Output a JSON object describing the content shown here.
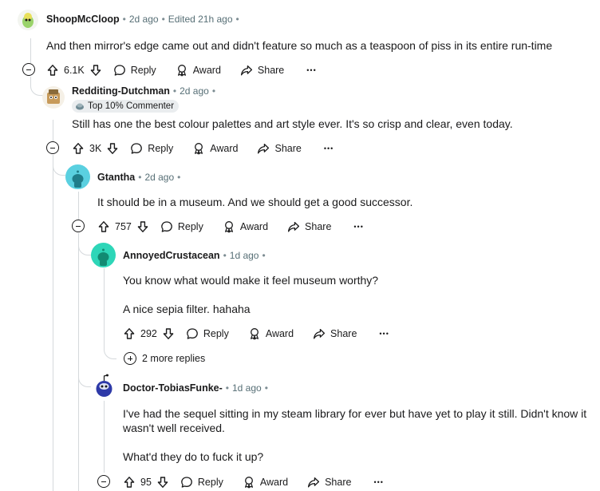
{
  "comments": [
    {
      "author": "ShoopMcCloop",
      "time": "2d ago",
      "edited": "Edited 21h ago",
      "body": [
        "And then mirror's edge came out and didn't feature so much as a teaspoon of piss in its entire run-time"
      ],
      "score": "6.1K"
    },
    {
      "author": "Redditing-Dutchman",
      "time": "2d ago",
      "badge": "Top 10% Commenter",
      "body": [
        "Still has one the best colour palettes and art style ever. It's so crisp and clear, even today."
      ],
      "score": "3K"
    },
    {
      "author": "Gtantha",
      "time": "2d ago",
      "body": [
        "It should be in a museum. And we should get a good successor."
      ],
      "score": "757"
    },
    {
      "author": "AnnoyedCrustacean",
      "time": "1d ago",
      "body": [
        "You know what would make it feel museum worthy?",
        "A nice sepia filter. hahaha"
      ],
      "score": "292",
      "more_replies": "2 more replies"
    },
    {
      "author": "Doctor-TobiasFunke-",
      "time": "1d ago",
      "body": [
        "I've had the sequel sitting in my steam library for ever but have yet to play it still. Didn't know it wasn't well received.",
        "What'd they do to fuck it up?"
      ],
      "score": "95"
    }
  ],
  "actions": {
    "reply": "Reply",
    "award": "Award",
    "share": "Share",
    "more": "•••"
  },
  "icons": {
    "upvote": "upvote-icon",
    "downvote": "downvote-icon",
    "reply": "reply-icon",
    "award": "award-icon",
    "share": "share-icon",
    "collapse": "collapse-icon",
    "expand": "expand-icon"
  },
  "colors": {
    "text": "#1a1a1b",
    "meta": "#576f76",
    "thread_line": "#d5d9dc",
    "snoo_teal": "#2ed6b8"
  }
}
